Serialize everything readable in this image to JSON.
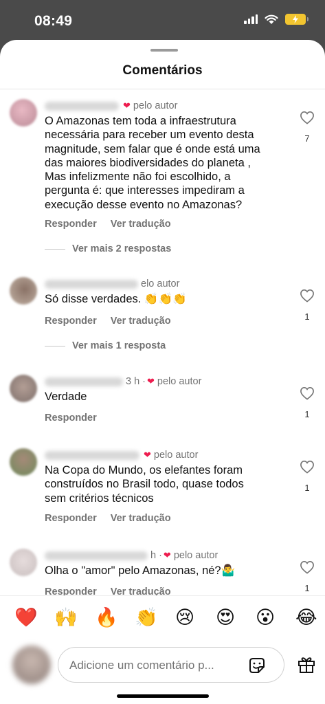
{
  "status_bar": {
    "time": "08:49"
  },
  "sheet": {
    "title": "Comentários"
  },
  "comments": [
    {
      "meta": "pelo autor",
      "text": "O Amazonas tem toda a infraestrutura\nnecessária para receber um evento desta\nmagnitude, sem falar que é onde está uma\ndas maiores  biodiversidades do planeta ,\nMas infelizmente não foi escolhido, a\npergunta é: que interesses impediram a\nexecução desse evento no Amazonas?",
      "reply": "Responder",
      "translate": "Ver tradução",
      "likes": "7",
      "more": "Ver mais 2 respostas"
    },
    {
      "meta": "elo autor",
      "text": "Só disse verdades. 👏👏👏",
      "reply": "Responder",
      "translate": "Ver tradução",
      "likes": "1",
      "more": "Ver mais 1 resposta"
    },
    {
      "meta_prefix": "3 h ·",
      "meta": "pelo autor",
      "text": "Verdade",
      "reply": "Responder",
      "likes": "1"
    },
    {
      "meta": "pelo autor",
      "text": "Na Copa do Mundo, os elefantes foram\nconstruídos no Brasil todo, quase todos\nsem critérios técnicos",
      "reply": "Responder",
      "translate": "Ver tradução",
      "likes": "1"
    },
    {
      "meta_prefix": "h ·",
      "meta": "pelo autor",
      "text": "Olha o \"amor\" pelo Amazonas, né?🤷‍♂️",
      "reply": "Responder",
      "translate": "Ver tradução",
      "likes": "1"
    }
  ],
  "reactions": [
    "❤️",
    "🙌",
    "🔥",
    "👏",
    "😢",
    "😍",
    "😮",
    "😂"
  ],
  "composer": {
    "placeholder": "Adicione um comentário p..."
  },
  "icons": {
    "heart": "heart-icon",
    "sticker": "sticker-icon",
    "gift": "gift-icon",
    "signal": "signal-icon",
    "wifi": "wifi-icon",
    "battery": "battery-icon"
  }
}
